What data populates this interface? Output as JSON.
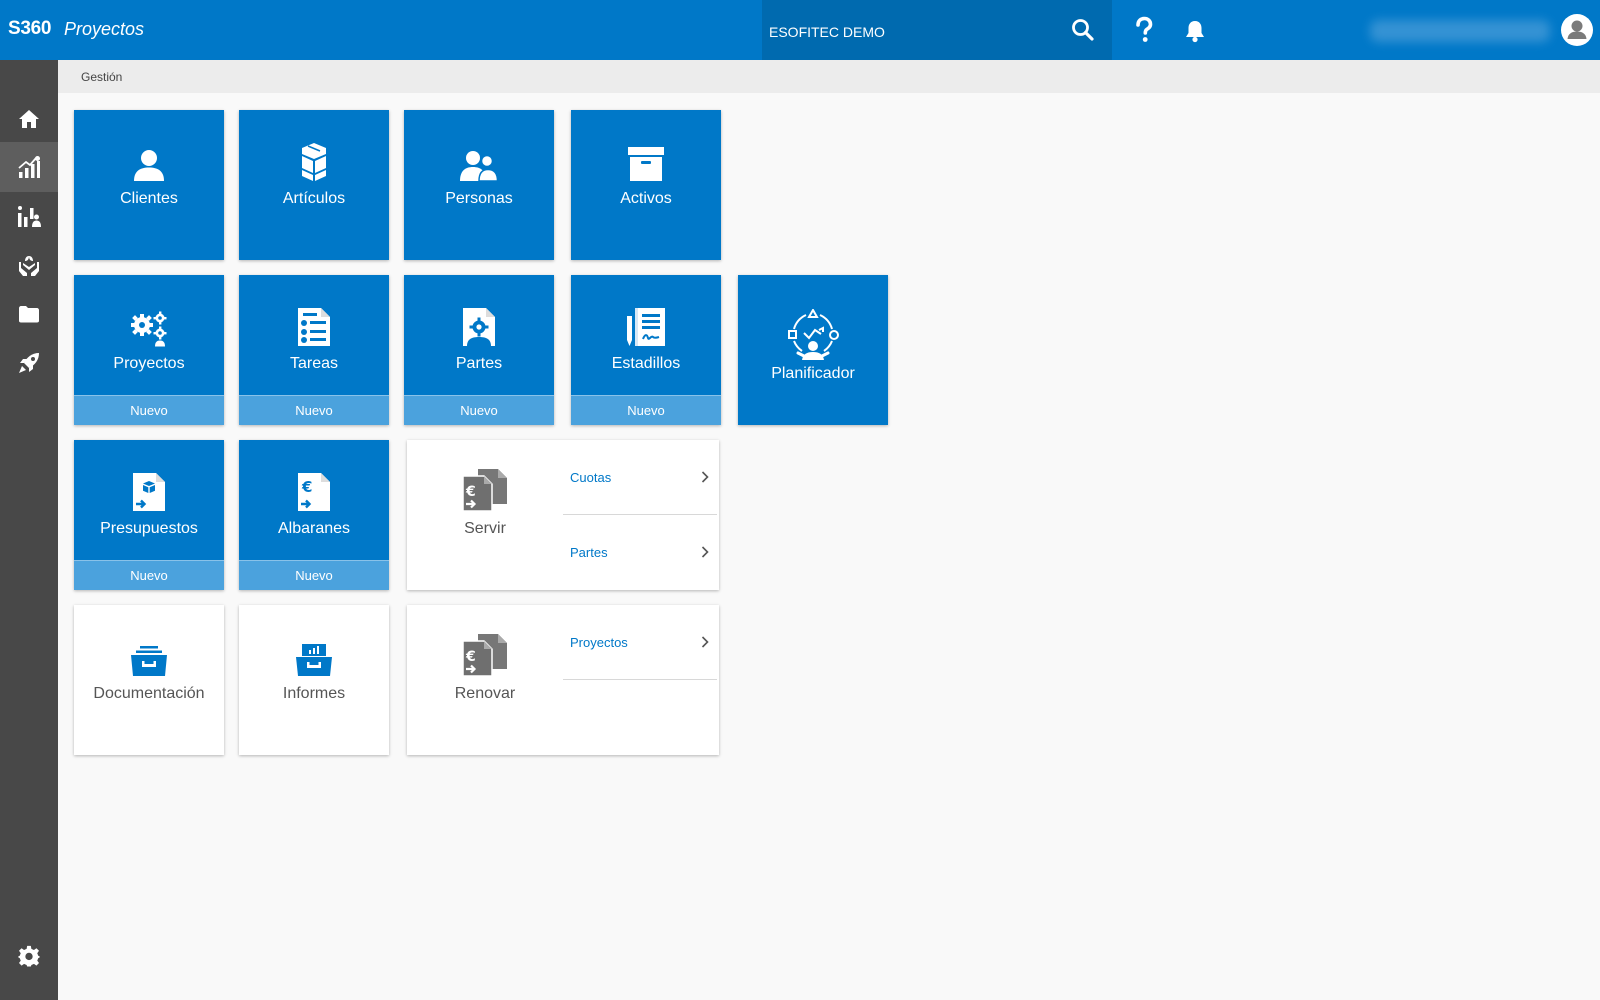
{
  "header": {
    "brand": "S360",
    "app_name": "Proyectos",
    "company": "ESOFITEC DEMO",
    "icons": [
      "search-icon",
      "help-icon",
      "bell-icon",
      "user-avatar-icon"
    ]
  },
  "sidebar": {
    "items": [
      {
        "name": "home",
        "icon": "home-icon"
      },
      {
        "name": "management",
        "icon": "chart-growth-icon",
        "active": true
      },
      {
        "name": "analytics",
        "icon": "chart-person-icon"
      },
      {
        "name": "care",
        "icon": "hands-plant-icon"
      },
      {
        "name": "files",
        "icon": "folder-icon"
      },
      {
        "name": "launch",
        "icon": "rocket-icon"
      },
      {
        "name": "settings",
        "icon": "gear-icon"
      }
    ]
  },
  "breadcrumb": "Gestión",
  "tiles": {
    "clientes": "Clientes",
    "articulos": "Artículos",
    "personas": "Personas",
    "activos": "Activos",
    "proyectos": "Proyectos",
    "tareas": "Tareas",
    "partes": "Partes",
    "estadillos": "Estadillos",
    "planificador": "Planificador",
    "presupuestos": "Presupuestos",
    "albaranes": "Albaranes",
    "documentacion": "Documentación",
    "informes": "Informes",
    "nuevo": "Nuevo"
  },
  "servir": {
    "label": "Servir",
    "links": [
      "Cuotas",
      "Partes"
    ]
  },
  "renovar": {
    "label": "Renovar",
    "links": [
      "Proyectos"
    ]
  },
  "colors": {
    "primary": "#0078c8",
    "company_bg": "#006aaf",
    "nuevo_bar": "#4ba2dd",
    "sidebar": "#484848",
    "icon_gray": "#6f6f6f"
  }
}
